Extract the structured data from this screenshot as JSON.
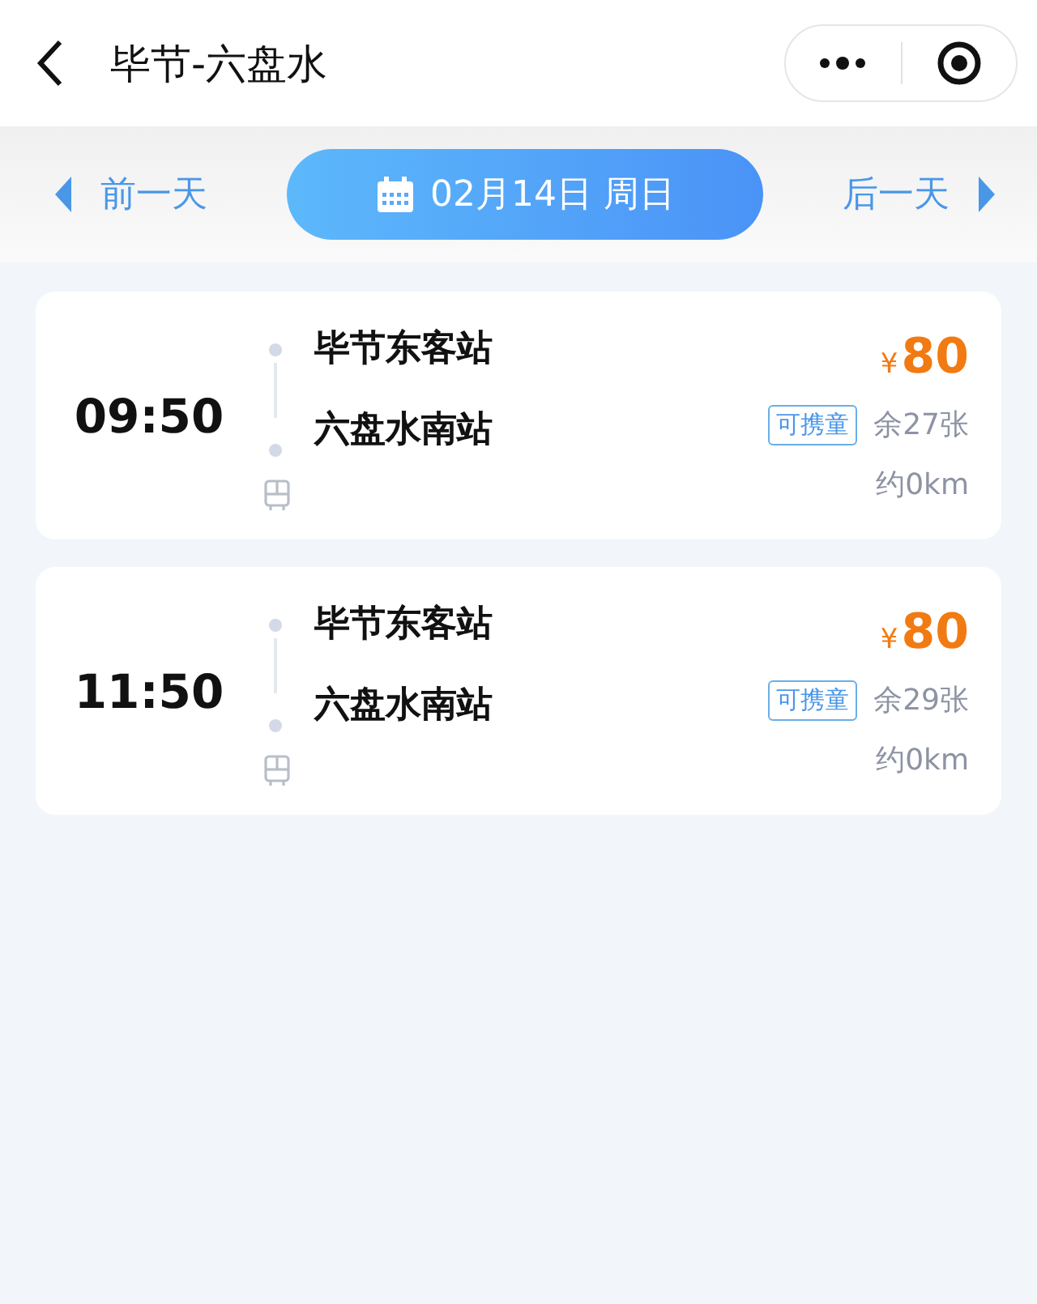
{
  "header": {
    "title": "毕节-六盘水"
  },
  "date_bar": {
    "prev": "前一天",
    "date": "02月14日 周日",
    "next": "后一天"
  },
  "trips": [
    {
      "time": "09:50",
      "from": "毕节东客站",
      "to": "六盘水南站",
      "currency": "¥",
      "price": "80",
      "tag": "可携童",
      "seats": "余27张",
      "distance": "约0km"
    },
    {
      "time": "11:50",
      "from": "毕节东客站",
      "to": "六盘水南站",
      "currency": "¥",
      "price": "80",
      "tag": "可携童",
      "seats": "余29张",
      "distance": "约0km"
    }
  ]
}
